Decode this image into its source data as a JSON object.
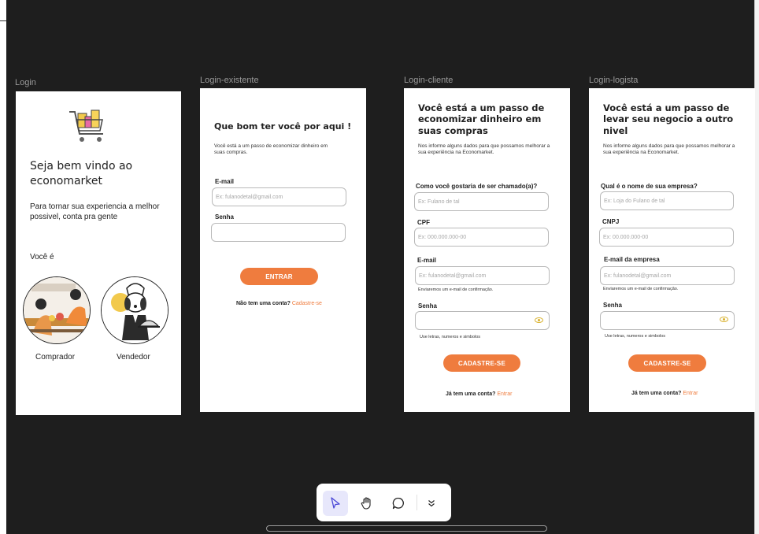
{
  "canvas": {
    "frames": [
      {
        "label": "Login"
      },
      {
        "label": "Login-existente"
      },
      {
        "label": "Login-cliente"
      },
      {
        "label": "Login-logista"
      }
    ]
  },
  "login": {
    "title": "Seja bem vindo  ao economarket",
    "subtitle": "Para tornar sua experiencia a melhor possivel, conta pra gente",
    "question": "Você é",
    "option_buyer": "Comprador",
    "option_seller": "Vendedor"
  },
  "existing": {
    "title": "Que bom ter você por aqui !",
    "desc": "Você está a um passo de economizar dinheiro em suas compras.",
    "email_label": "E-mail",
    "email_placeholder": "Ex: fulanodetal@gmail.com",
    "password_label": "Senha",
    "button": "ENTRAR",
    "footer_text": "Não tem uma conta?",
    "footer_link": "Cadastre-se"
  },
  "client": {
    "title": "Você está a um passo de economizar dinheiro em suas compras",
    "desc": "Nos informe alguns dados para que possamos melhorar a sua experiência na Economarket.",
    "name_label": "Como você gostaria de ser chamado(a)?",
    "name_placeholder": "Ex: Fulano de tal",
    "cpf_label": "CPF",
    "cpf_placeholder": "Ex: 000.000.000-00",
    "email_label": "E-mail",
    "email_placeholder": "Ex: fulanodetal@gmail.com",
    "email_hint": "Enviaremos um e-mail de confirmação.",
    "password_label": "Senha",
    "password_hint": "Use letras, numeros e simbolos",
    "button": "CADASTRE-SE",
    "footer_text": "Já tem uma conta?",
    "footer_link": "Entrar"
  },
  "merchant": {
    "title": "Você está a um passo de levar seu negocio a outro nivel",
    "desc": "Nos informe alguns dados para que possamos melhorar a sua experiência na Economarket.",
    "company_label": "Qual é o nome de sua empresa?",
    "company_placeholder": "Ex: Loja do Fulano de tal",
    "cnpj_label": "CNPJ",
    "cnpj_placeholder": "Ex: 00.000.000-00",
    "email_label": "E-mail da empresa",
    "email_placeholder": "Ex: fulanodetal@gmail.com",
    "email_hint": "Enviaremos um e-mail de confirmação.",
    "password_label": "Senha",
    "password_hint": "Use letras, numeros e simbolos",
    "button": "CADASTRE-SE",
    "footer_text": "Já tem uma conta?",
    "footer_link": "Entrar"
  },
  "toolbar": {
    "tools": [
      "pointer-icon",
      "hand-icon",
      "comment-icon",
      "chevron-down-icon"
    ]
  },
  "colors": {
    "accent": "#ef7c3e",
    "canvas": "#1e1e1e",
    "eye": "#d8b02a"
  }
}
